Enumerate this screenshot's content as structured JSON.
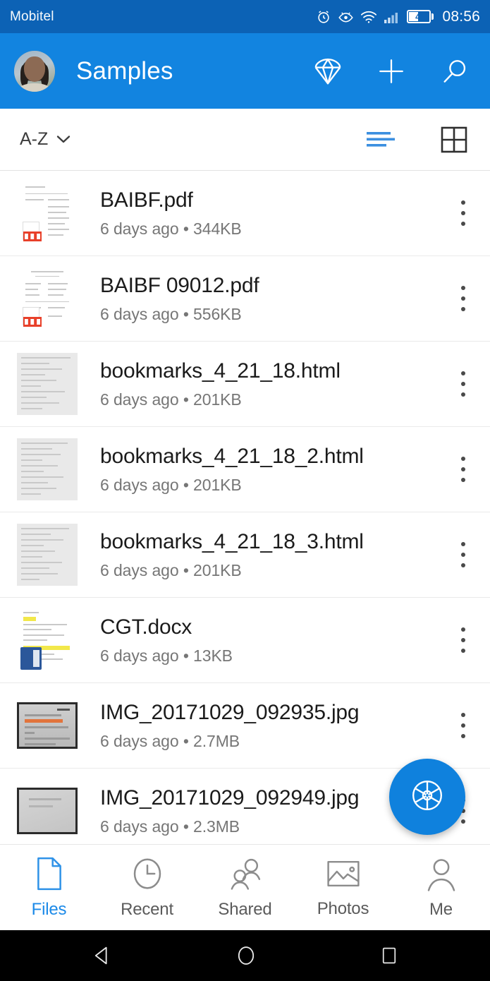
{
  "status_bar": {
    "carrier": "Mobitel",
    "battery_percent": "41",
    "time": "08:56",
    "icons": [
      "alarm-clock-icon",
      "eye-comfort-icon",
      "wifi-icon",
      "cellular-signal-icon",
      "battery-icon"
    ]
  },
  "app_bar": {
    "title": "Samples",
    "avatar": "user-avatar",
    "actions": [
      {
        "name": "premium-diamond-icon",
        "label": "Premium"
      },
      {
        "name": "add-icon",
        "label": "Add"
      },
      {
        "name": "search-icon",
        "label": "Search"
      }
    ]
  },
  "toolbar": {
    "sort_label": "A-Z",
    "sort_chevron": "chevron-down-icon",
    "list_view": "list-view-icon",
    "grid_view": "grid-view-icon",
    "active_view": "list",
    "accent_color": "#1c8ae8"
  },
  "files": [
    {
      "name": "BAIBF.pdf",
      "modified": "6 days ago",
      "size": "344KB",
      "sub": "6 days ago • 344KB",
      "kind": "pdf"
    },
    {
      "name": "BAIBF 09012.pdf",
      "modified": "6 days ago",
      "size": "556KB",
      "sub": "6 days ago • 556KB",
      "kind": "pdf"
    },
    {
      "name": "bookmarks_4_21_18.html",
      "modified": "6 days ago",
      "size": "201KB",
      "sub": "6 days ago • 201KB",
      "kind": "html"
    },
    {
      "name": "bookmarks_4_21_18_2.html",
      "modified": "6 days ago",
      "size": "201KB",
      "sub": "6 days ago • 201KB",
      "kind": "html"
    },
    {
      "name": "bookmarks_4_21_18_3.html",
      "modified": "6 days ago",
      "size": "201KB",
      "sub": "6 days ago • 201KB",
      "kind": "html"
    },
    {
      "name": "CGT.docx",
      "modified": "6 days ago",
      "size": "13KB",
      "sub": "6 days ago • 13KB",
      "kind": "docx"
    },
    {
      "name": "IMG_20171029_092935.jpg",
      "modified": "6 days ago",
      "size": "2.7MB",
      "sub": "6 days ago • 2.7MB",
      "kind": "jpg"
    },
    {
      "name": "IMG_20171029_092949.jpg",
      "modified": "6 days ago",
      "size": "2.3MB",
      "sub": "6 days ago • 2.3MB",
      "kind": "jpg"
    }
  ],
  "fab": {
    "icon": "camera-shutter-icon",
    "color": "#0f81dd"
  },
  "bottom_nav": {
    "active": "Files",
    "items": [
      {
        "label": "Files",
        "icon": "document-icon"
      },
      {
        "label": "Recent",
        "icon": "clock-icon"
      },
      {
        "label": "Shared",
        "icon": "people-icon"
      },
      {
        "label": "Photos",
        "icon": "photo-icon"
      },
      {
        "label": "Me",
        "icon": "person-icon"
      }
    ]
  },
  "android_nav": {
    "back": "back-triangle-icon",
    "home": "home-circle-icon",
    "recents": "recents-square-icon"
  }
}
